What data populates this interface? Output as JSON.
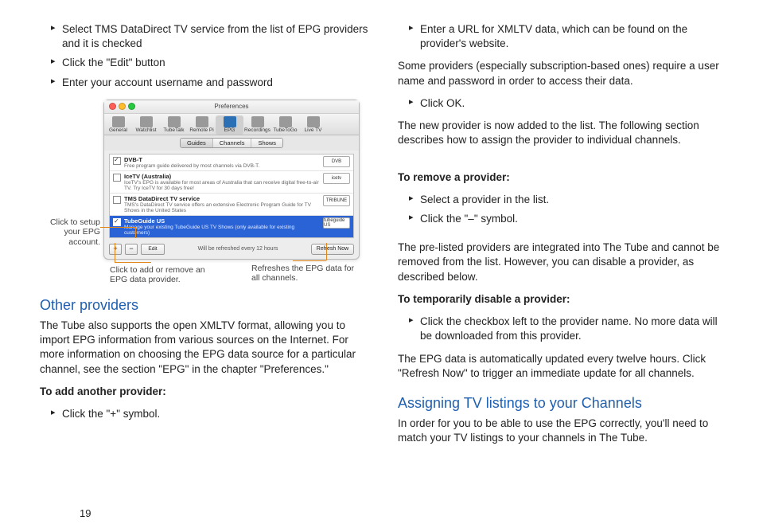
{
  "page_number": "19",
  "left": {
    "bullets_top": [
      "Select TMS DataDirect TV service from the list of EPG providers and it is checked",
      "Click the \"Edit\" button",
      "Enter your account username and password"
    ],
    "section_heading": "Other providers",
    "section_body": "The Tube also supports the open XMLTV format, allowing you to import EPG information from various sources on the Internet. For more information on choosing the EPG data source for a particular channel, see the section \"EPG\" in the chapter \"Preferences.\"",
    "add_heading": "To add another provider:",
    "add_bullets": [
      "Click the \"+\" symbol."
    ]
  },
  "right": {
    "bullets_top": [
      "Enter a URL for XMLTV data, which can be found on the provider's website."
    ],
    "para1": "Some providers (especially subscription-based ones) require a user name and password in order to access their data.",
    "bullets_ok": [
      "Click OK."
    ],
    "para2": "The new provider is now added to the list. The following section describes how to assign the provider to individual channels.",
    "remove_heading": "To remove a provider:",
    "remove_bullets": [
      "Select a provider in the list.",
      "Click the \"–\" symbol."
    ],
    "para3": "The pre-listed providers are integrated into The Tube and cannot be removed from the list. However, you can disable a provider, as described below.",
    "disable_heading": "To temporarily disable a provider:",
    "disable_bullets": [
      "Click the checkbox left to the provider name. No more data will be downloaded from this provider."
    ],
    "para4": "The EPG data is automatically updated every twelve hours. Click \"Refresh Now\" to trigger an immediate update for all channels.",
    "assign_heading": "Assigning TV listings to your Channels",
    "assign_body": "In order for you to be able to use the EPG correctly, you'll need to match your TV listings to your channels in The Tube."
  },
  "prefs": {
    "title": "Preferences",
    "toolbar": [
      "General",
      "Watchlist",
      "TubeTalk",
      "Remote Pi",
      "EPG",
      "Recordings",
      "TubeToGo",
      "Live TV"
    ],
    "tabs": [
      "Guides",
      "Channels",
      "Shows"
    ],
    "providers": [
      {
        "checked": true,
        "name": "DVB-T",
        "desc": "Free program guide delivered by most channels via DVB-T.",
        "badge": "DVB"
      },
      {
        "checked": false,
        "name": "IceTV (Australia)",
        "desc": "IceTV's EPG is available for most areas of Australia that can receive digital free-to-air TV. Try IceTV for 30 days free!",
        "badge": "icetv"
      },
      {
        "checked": false,
        "name": "TMS DataDirect TV service",
        "desc": "TMS's DataDirect TV service offers an extensive Electronic Program Guide for TV Shows in the United States",
        "badge": "TRIBUNE"
      },
      {
        "checked": true,
        "name": "TubeGuide US",
        "desc": "Manage your existing TubeGuide US TV Shows (only available for existing customers)",
        "badge": "tubeguide US",
        "selected": true
      }
    ],
    "refresh_text": "Will be refreshed every 12 hours",
    "refresh_btn": "Refresh Now",
    "edit_btn": "Edit"
  },
  "callouts": {
    "left": "Click to setup your EPG account.",
    "bottom1": "Click to add or remove an EPG data provider.",
    "bottom2": "Refreshes the EPG data for all channels."
  }
}
